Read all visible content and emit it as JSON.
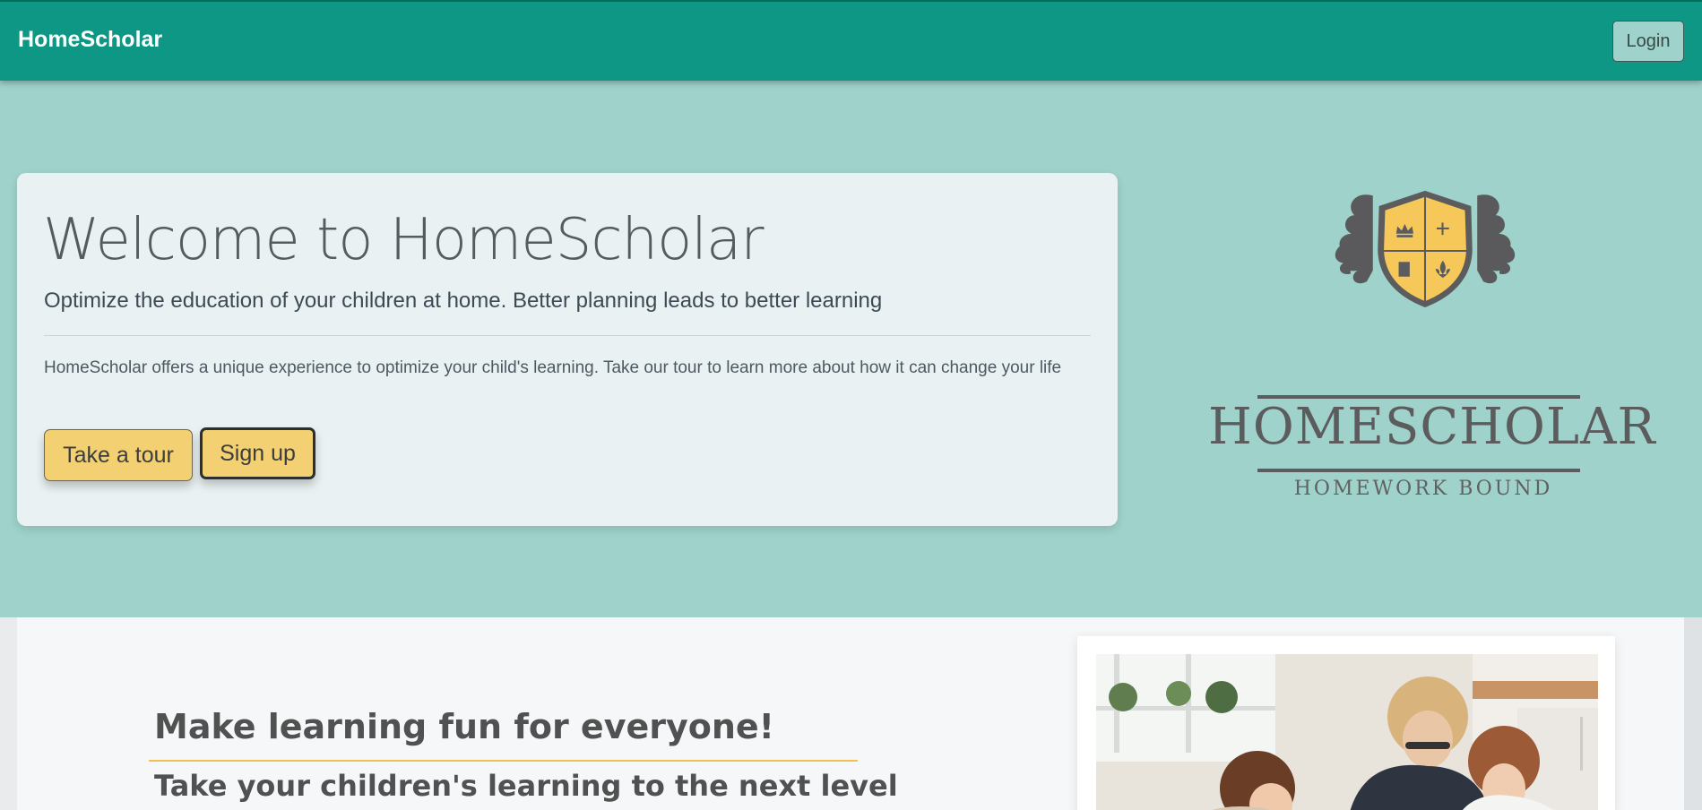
{
  "navbar": {
    "brand": "HomeScholar",
    "login_label": "Login"
  },
  "hero": {
    "title": "Welcome to HomeScholar",
    "subtitle": "Optimize the education of your children at home. Better planning leads to better learning",
    "description": "HomeScholar offers a unique experience to optimize your child's learning. Take our tour to learn more about how it can change your life",
    "tour_label": "Take a tour",
    "signup_label": "Sign up"
  },
  "logo": {
    "name": "HOMESCHOLAR",
    "tagline": "HOMEWORK BOUND",
    "icon": "crest-shield-icon"
  },
  "section": {
    "heading": "Make learning fun for everyone!",
    "subheading": "Take your children's learning to the next level"
  },
  "colors": {
    "navbar": "#0e9784",
    "hero_bg": "#9ed2ca",
    "button_yellow": "#f3d072",
    "logo_gray": "#5c5c5e",
    "shield_gold": "#f6c85a"
  }
}
